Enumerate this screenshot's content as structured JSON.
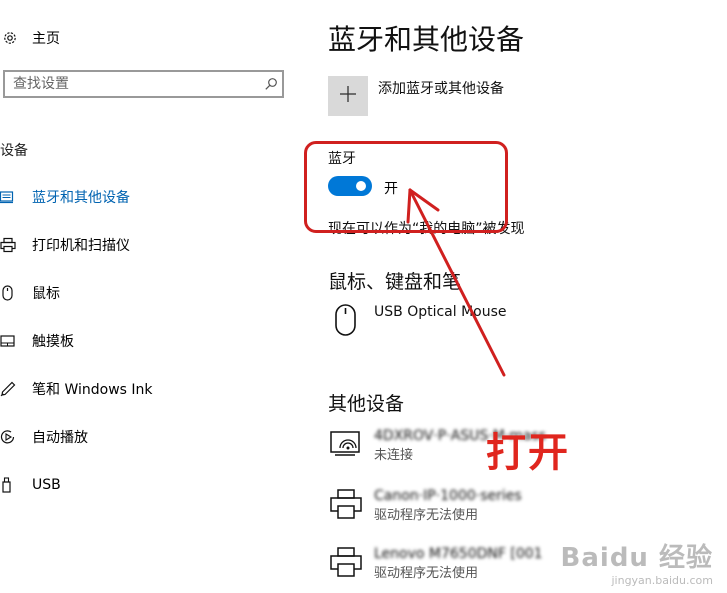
{
  "sidebar": {
    "home_label": "主页",
    "search_placeholder": "查找设置",
    "section_label": "设备",
    "items": [
      {
        "label": "蓝牙和其他设备",
        "icon": "bluetooth-devices-icon",
        "active": true
      },
      {
        "label": "打印机和扫描仪",
        "icon": "printer-icon"
      },
      {
        "label": "鼠标",
        "icon": "mouse-icon"
      },
      {
        "label": "触摸板",
        "icon": "touchpad-icon"
      },
      {
        "label": "笔和 Windows Ink",
        "icon": "pen-icon"
      },
      {
        "label": "自动播放",
        "icon": "autoplay-icon"
      },
      {
        "label": "USB",
        "icon": "usb-icon"
      }
    ]
  },
  "main": {
    "title": "蓝牙和其他设备",
    "add_device_label": "添加蓝牙或其他设备",
    "bluetooth": {
      "label": "蓝牙",
      "state": "开",
      "discoverable_text": "现在可以作为“我的电脑”被发现"
    },
    "mouse_section": {
      "title": "鼠标、键盘和笔",
      "devices": [
        {
          "name": "USB Optical Mouse",
          "icon": "mouse-icon"
        }
      ]
    },
    "other_section": {
      "title": "其他设备",
      "devices": [
        {
          "name": "4DXROV·P·ASUS·M·mass",
          "status": "未连接",
          "icon": "wireless-display-icon"
        },
        {
          "name": "Canon·IP·1000·series",
          "status": "驱动程序无法使用",
          "icon": "printer-icon"
        },
        {
          "name": "Lenovo M7650DNF [001",
          "status": "驱动程序无法使用",
          "icon": "printer-icon"
        }
      ]
    }
  },
  "annotation": {
    "text": "打开",
    "color": "#e0261e"
  },
  "watermark": {
    "line1": "Baidu 经验",
    "line2": "jingyan.baidu.com"
  },
  "colors": {
    "accent": "#0078d7",
    "active_text": "#0063b1",
    "annotation": "#d0201f"
  }
}
